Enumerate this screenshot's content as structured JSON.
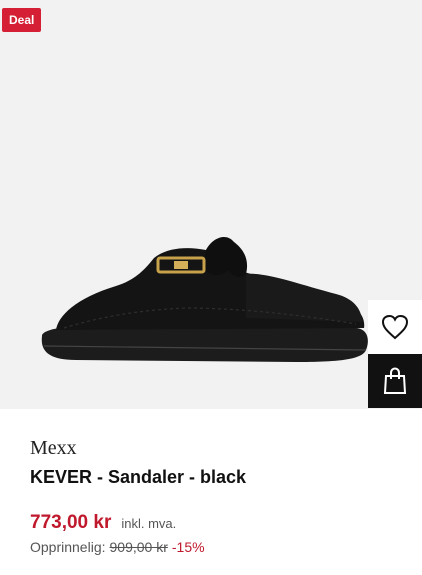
{
  "badge": {
    "label": "Deal"
  },
  "product": {
    "brand": "Mexx",
    "name": "KEVER - Sandaler - black",
    "price": "773,00 kr",
    "vat_note": "inkl. mva.",
    "original_label": "Opprinnelig:",
    "original_price": "909,00 kr",
    "discount": "-15%"
  },
  "icons": {
    "wishlist": "heart-icon",
    "cart": "shopping-bag-icon"
  },
  "colors": {
    "deal": "#d51f34",
    "price": "#c0182c",
    "cart_button_bg": "#111111"
  }
}
